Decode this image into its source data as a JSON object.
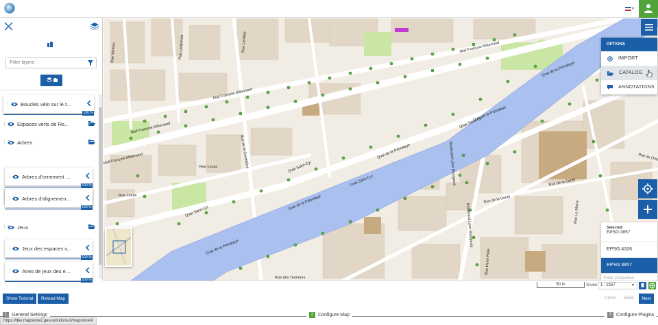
{
  "layers": {
    "filter_placeholder": "Filter layers",
    "items": [
      {
        "label": "Boucles vélo sur le t...",
        "type": "layer",
        "opacity": "100 %"
      },
      {
        "label": "Espaces verts de Re...",
        "type": "group"
      },
      {
        "label": "Arbres",
        "type": "group"
      },
      {
        "label": "Arbres d'ornement p...",
        "type": "layer",
        "opacity": "100 %"
      },
      {
        "label": "Arbres d'alignement...",
        "type": "layer",
        "opacity": "100 %"
      },
      {
        "label": "Jeux",
        "type": "group"
      },
      {
        "label": "Jeux des espaces v...",
        "type": "layer",
        "opacity": "100 %"
      },
      {
        "label": "Aires de jeux des es...",
        "type": "layer",
        "opacity": "100 %"
      }
    ]
  },
  "options_menu": {
    "title": "OPTIONS",
    "items": [
      {
        "label": "IMPORT",
        "icon": "import-icon"
      },
      {
        "label": "CATALOG",
        "icon": "folder-open-icon"
      },
      {
        "label": "ANNOTATIONS",
        "icon": "comment-icon"
      }
    ]
  },
  "map_labels": {
    "mitterrand": "Mail François Mitterrand",
    "saint_cyr": "Quai Saint-Cyr",
    "prevalaye": "Quai de la Prévalaye",
    "lucas": "Rue Lucas",
    "sante": "Rue de la Santé",
    "leon_bourgeois": "Boulevard Léon Bourgeois",
    "landais": "Rue Landais",
    "lanjuinais": "Rue Lanjuinais",
    "cordeliere": "Rue de la Cordelière",
    "vaneau": "Rue Vaneau",
    "le_moine": "Rue Le Moine",
    "henri_pelle": "Rue Henri Pelle",
    "des_tanneurs": "Rue des Tanneurs",
    "vicompte": "Rue Vicomte",
    "alexandre_paris": "Rue Alexandre Paris",
    "de_la_sante_right": "Rue de la Santé",
    "docteur_bleau": "Rue du Docteur Bleau"
  },
  "crs": {
    "selected_label": "Selected:",
    "selected_value": "EPSG:3857",
    "options": [
      "EPSG:4326",
      "EPSG:3857"
    ],
    "filter_placeholder": "Filter projection"
  },
  "scale": {
    "bar_label": "50 m",
    "label": "Scale",
    "value": "1 : 2257"
  },
  "toolbar": {
    "show_tutorial": "Show Tutorial",
    "reload_map": "Reload Map",
    "close": "Close",
    "back": "Back",
    "next": "Next"
  },
  "wizard_steps": [
    {
      "num": "1",
      "label": "General Settings"
    },
    {
      "num": "2",
      "label": "Configure Map"
    },
    {
      "num": "3",
      "label": "Configure Plugins"
    }
  ],
  "status_url": "https://dev.mapstore2.geo-solutions.it/mapstore/#",
  "colors": {
    "primary": "#1b5fa8",
    "accent_green": "#52a33a",
    "water": "#aac0ef",
    "park": "#c9e6a4"
  }
}
